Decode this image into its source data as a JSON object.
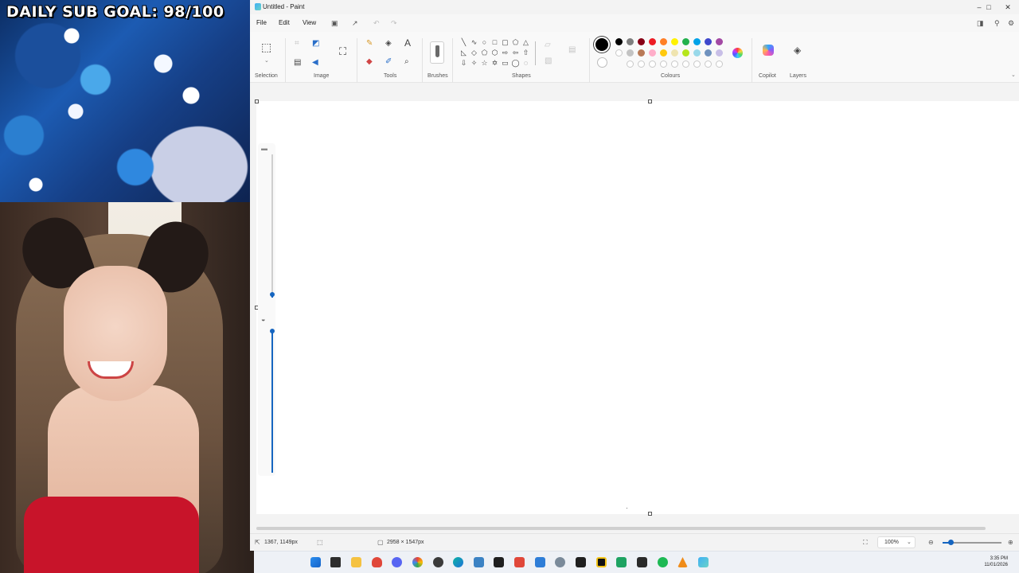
{
  "overlay": {
    "goal_text": "DAILY SUB GOAL: 98/100"
  },
  "window": {
    "title": "Untitled - Paint",
    "minimize": "–",
    "maximize": "□",
    "close": "✕"
  },
  "menu": {
    "file": "File",
    "edit": "Edit",
    "view": "View"
  },
  "ribbon": {
    "groups": {
      "selection": "Selection",
      "image": "Image",
      "tools": "Tools",
      "brushes": "Brushes",
      "shapes": "Shapes",
      "colours": "Colours",
      "copilot": "Copilot",
      "layers": "Layers"
    },
    "tools": {
      "text_icon": "A"
    },
    "palette_row1": [
      "#000000",
      "#7f7f7f",
      "#880015",
      "#ed1c24",
      "#ff7f27",
      "#fff200",
      "#22b14c",
      "#00a2e8",
      "#3f48cc",
      "#a349a4"
    ],
    "palette_row2": [
      "",
      "#c3c3c3",
      "#b97a57",
      "#ffaec9",
      "#ffc90e",
      "#efe4b0",
      "#b5e61d",
      "#99d9ea",
      "#7092be",
      "#c8bfe7"
    ],
    "primary_colour": "#000000",
    "secondary_colour": "#ffffff"
  },
  "status": {
    "cursor_position": "1367, 1149px",
    "canvas_size": "2958 × 1547px",
    "zoom": "100%"
  },
  "taskbar": {
    "time": "3:35 PM",
    "date": "11/01/2026"
  }
}
